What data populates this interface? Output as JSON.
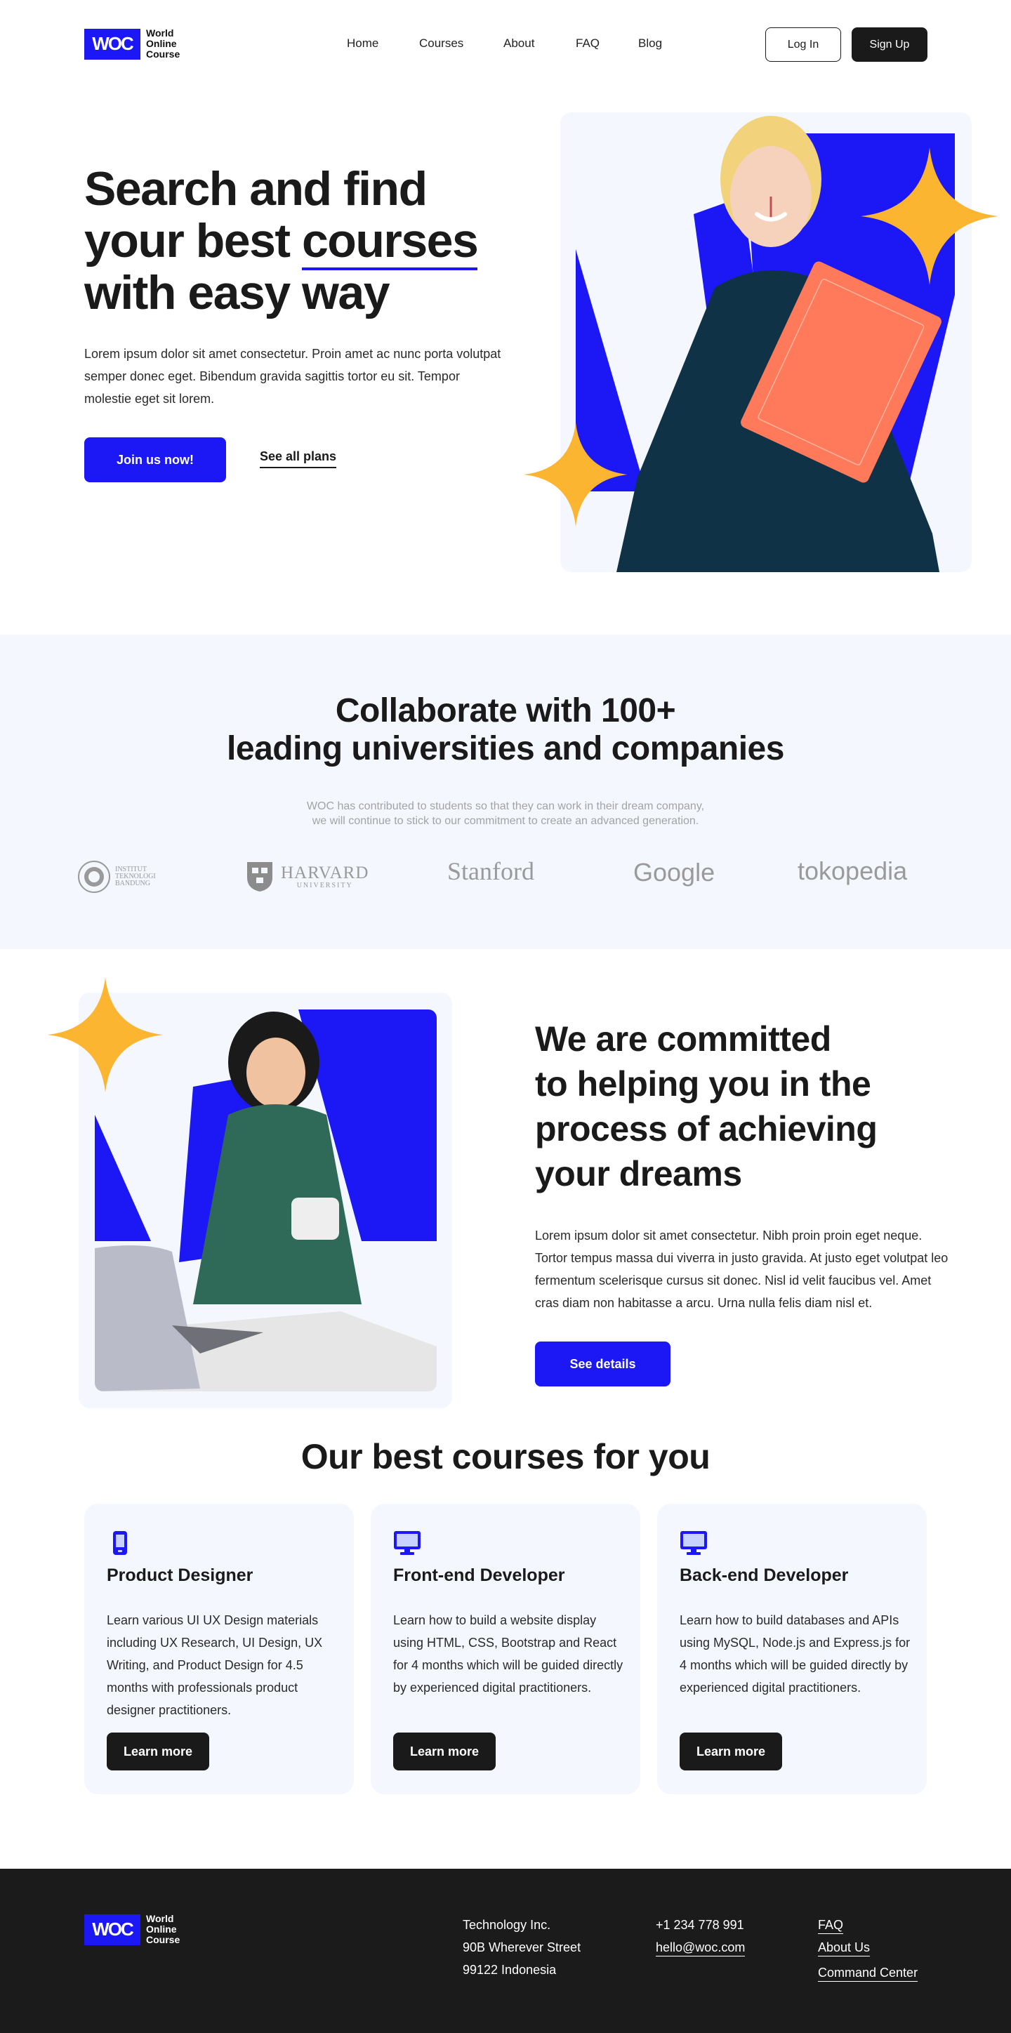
{
  "header": {
    "logo_mark": "WOC",
    "logo_line1": "World",
    "logo_line2": "Online",
    "logo_line3": "Course",
    "nav": [
      "Home",
      "Courses",
      "About",
      "FAQ",
      "Blog"
    ],
    "login_label": "Log In",
    "signup_label": "Sign Up"
  },
  "hero": {
    "title_line1": "Search and find",
    "title_line2_pre": "your best ",
    "title_line2_highlight": "courses",
    "title_line3": "with easy way",
    "description": "Lorem ipsum dolor sit amet consectetur. Proin amet ac nunc porta volutpat semper donec eget. Bibendum gravida sagittis tortor eu sit. Tempor molestie eget sit lorem.",
    "primary_cta": "Join us now!",
    "secondary_cta": "See all plans"
  },
  "partners": {
    "title_line1": "Collaborate with 100+",
    "title_line2": "leading universities and companies",
    "subtitle_line1": "WOC has contributed to students so that they can work in their dream company,",
    "subtitle_line2": "we will continue to stick to our commitment to create an advanced generation.",
    "itb_line1": "INSTITUT",
    "itb_line2": "TEKNOLOGI",
    "itb_line3": "BANDUNG",
    "harvard_name": "HARVARD",
    "harvard_sub": "UNIVERSITY",
    "stanford": "Stanford",
    "google": "Google",
    "tokopedia": "tokopedia"
  },
  "commitment": {
    "title_line1": "We are committed",
    "title_line2": "to helping you in the",
    "title_line3": "process of achieving",
    "title_line4": "your dreams",
    "description": "Lorem ipsum dolor sit amet consectetur. Nibh proin proin eget neque. Tortor tempus massa dui viverra in justo gravida. At justo eget volutpat leo fermentum scelerisque cursus sit donec. Nisl id velit faucibus vel. Amet cras diam non habitasse a arcu. Urna nulla felis diam nisl et.",
    "cta": "See details"
  },
  "courses": {
    "title": "Our best courses for you",
    "items": [
      {
        "icon": "mobile-icon",
        "title": "Product Designer",
        "description": "Learn various UI UX Design materials including UX Research, UI Design, UX Writing, and Product Design for 4.5 months with professionals  product designer practitioners.",
        "cta": "Learn more"
      },
      {
        "icon": "monitor-icon",
        "title": "Front-end Developer",
        "description": "Learn how to build a website display using HTML, CSS, Bootstrap and React for 4 months which will be guided directly by experienced digital practitioners.",
        "cta": "Learn more"
      },
      {
        "icon": "monitor-icon",
        "title": "Back-end Developer",
        "description": "Learn how to build databases and APIs using MySQL, Node.js and Express.js for 4 months which will be guided directly by experienced digital practitioners.",
        "cta": "Learn more"
      }
    ]
  },
  "footer": {
    "company": "Technology Inc.",
    "address1": "90B Wherever Street",
    "address2": "99122 Indonesia",
    "phone": "+1 234 778 991",
    "email": "hello@woc.com",
    "links": [
      "FAQ",
      "About Us",
      "Command Center"
    ]
  },
  "colors": {
    "brand_blue": "#1b17f5",
    "star_yellow": "#fbb531",
    "dark": "#1a1a1a",
    "section_bg": "#f4f7fe"
  }
}
